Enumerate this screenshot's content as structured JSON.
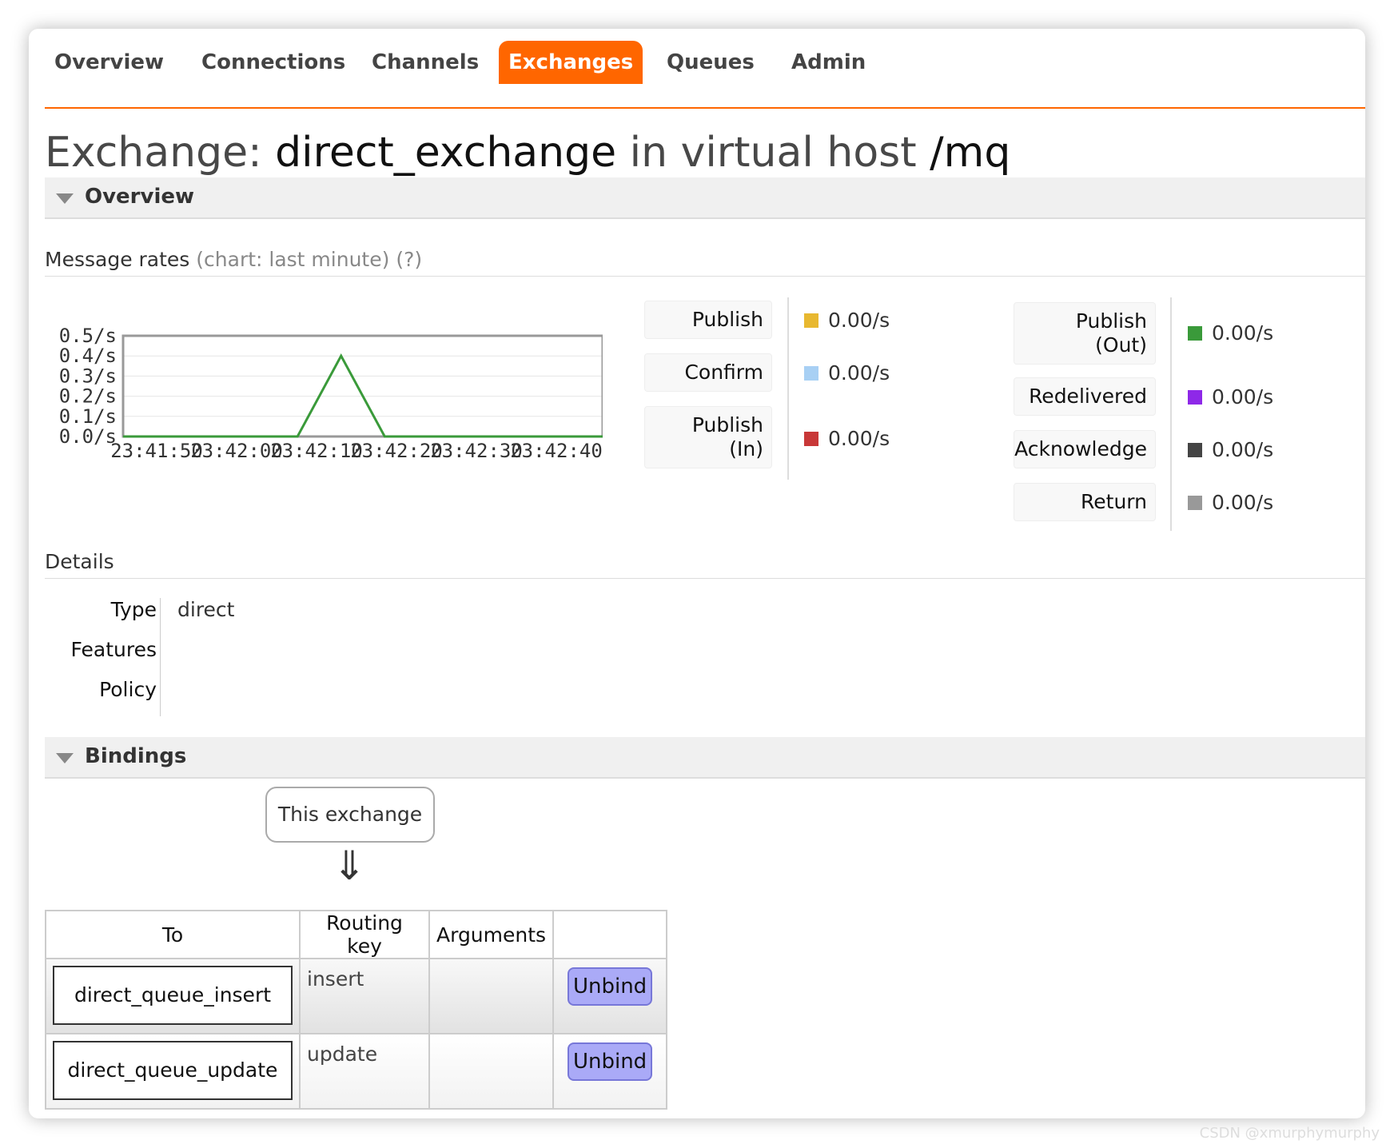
{
  "nav": {
    "tabs": [
      {
        "label": "Overview",
        "active": false
      },
      {
        "label": "Connections",
        "active": false
      },
      {
        "label": "Channels",
        "active": false
      },
      {
        "label": "Exchanges",
        "active": true
      },
      {
        "label": "Queues",
        "active": false
      },
      {
        "label": "Admin",
        "active": false
      }
    ],
    "accent_color": "#ff6600"
  },
  "title": {
    "prefix": "Exchange: ",
    "exchange_name": "direct_exchange",
    "middle": " in virtual host ",
    "vhost": "/mq"
  },
  "overview": {
    "section_label": "Overview",
    "message_rates_label": "Message rates",
    "chart_note": "(chart: last minute)",
    "help": "(?)"
  },
  "chart_data": {
    "type": "line",
    "x": [
      "23:41:50",
      "23:41:55",
      "23:42:00",
      "23:42:05",
      "23:42:10",
      "23:42:15",
      "23:42:20",
      "23:42:25",
      "23:42:30",
      "23:42:35",
      "23:42:40",
      "23:42:45"
    ],
    "x_tick_labels": [
      "23:41:50",
      "23:42:00",
      "23:42:10",
      "23:42:20",
      "23:42:30",
      "23:42:40"
    ],
    "y_tick_labels": [
      "0.5/s",
      "0.4/s",
      "0.3/s",
      "0.2/s",
      "0.1/s",
      "0.0/s"
    ],
    "ylim": [
      0,
      0.5
    ],
    "grid": true,
    "series": [
      {
        "color": "#3a9a3a",
        "values": [
          0,
          0,
          0,
          0,
          0,
          0.4,
          0,
          0,
          0,
          0,
          0,
          0
        ]
      }
    ]
  },
  "rates_left": [
    {
      "label": "Publish",
      "value": "0.00/s",
      "color": "#e8b830"
    },
    {
      "label": "Confirm",
      "value": "0.00/s",
      "color": "#a8d0f4"
    },
    {
      "label_line1": "Publish",
      "label_line2": "(In)",
      "value": "0.00/s",
      "color": "#c83838"
    }
  ],
  "rates_right": [
    {
      "label_line1": "Publish",
      "label_line2": "(Out)",
      "value": "0.00/s",
      "color": "#3a9a3a"
    },
    {
      "label": "Redelivered",
      "value": "0.00/s",
      "color": "#8e28e8"
    },
    {
      "label": "Acknowledge",
      "value": "0.00/s",
      "color": "#444444"
    },
    {
      "label": "Return",
      "value": "0.00/s",
      "color": "#999999"
    }
  ],
  "details": {
    "heading": "Details",
    "rows": [
      {
        "label": "Type",
        "value": "direct"
      },
      {
        "label": "Features",
        "value": ""
      },
      {
        "label": "Policy",
        "value": ""
      }
    ]
  },
  "bindings": {
    "section_label": "Bindings",
    "this_exchange": "This exchange",
    "arrow": "⇓",
    "headers": [
      "To",
      "Routing key",
      "Arguments",
      ""
    ],
    "rows": [
      {
        "to": "direct_queue_insert",
        "routing_key": "insert",
        "arguments": "",
        "action": "Unbind"
      },
      {
        "to": "direct_queue_update",
        "routing_key": "update",
        "arguments": "",
        "action": "Unbind"
      }
    ]
  },
  "watermark": "CSDN @xmurphymurphy"
}
